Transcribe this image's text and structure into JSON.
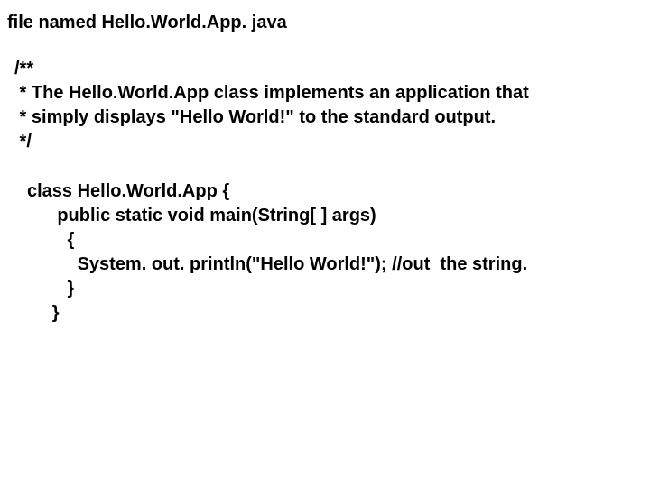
{
  "heading": "file named Hello.World.App. java",
  "comment": {
    "l1": "/**",
    "l2": " * The Hello.World.App class implements an application that",
    "l3": " * simply displays \"Hello World!\" to the standard output.",
    "l4": " */"
  },
  "code": {
    "l1": "class Hello.World.App {",
    "l2": "      public static void main(String[ ] args)",
    "l3": "        {",
    "l4": "          System. out. println(\"Hello World!\"); //out  the string.",
    "l5": "        }",
    "l6": "     }"
  }
}
